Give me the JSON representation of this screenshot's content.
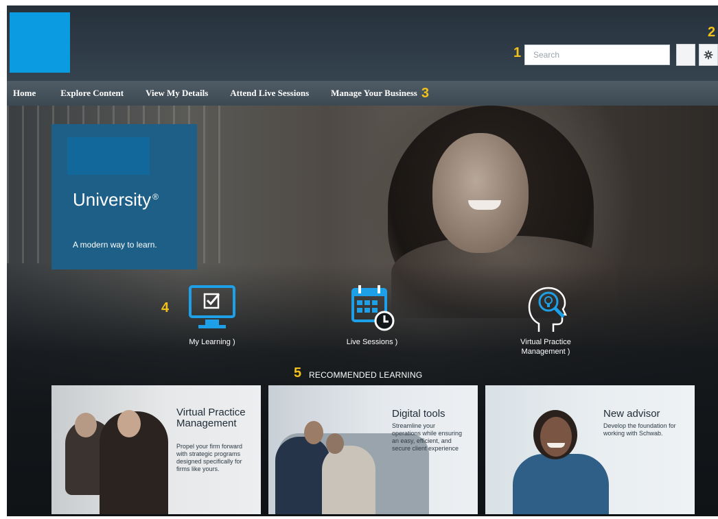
{
  "callouts": [
    "1",
    "2",
    "3",
    "4",
    "5"
  ],
  "header": {
    "search_placeholder": "Search"
  },
  "nav": {
    "items": [
      {
        "label": "Home"
      },
      {
        "label": "Explore Content"
      },
      {
        "label": "View My Details"
      },
      {
        "label": "Attend Live Sessions"
      },
      {
        "label": "Manage Your Business"
      }
    ]
  },
  "hero": {
    "brand_title": "University",
    "brand_mark": "®",
    "brand_tagline": "A modern way to learn."
  },
  "quick_links": [
    {
      "label": "My Learning )",
      "icon": "monitor-checkbox-icon"
    },
    {
      "label": "Live Sessions )",
      "icon": "calendar-clock-icon"
    },
    {
      "label": "Virtual Practice Management )",
      "icon": "head-lightbulb-icon"
    }
  ],
  "recommended": {
    "heading": "RECOMMENDED LEARNING",
    "cards": [
      {
        "title": "Virtual Practice Management",
        "description": "Propel your firm forward with strategic programs designed specifically for firms like yours."
      },
      {
        "title": "Digital tools",
        "description": "Streamline your operations while ensuring an easy, efficient, and secure client experience"
      },
      {
        "title": "New advisor",
        "description": "Develop the foundation for working with Schwab."
      }
    ]
  },
  "colors": {
    "logo_blue": "#0a9be0",
    "brand_panel": "#1d5f86",
    "icon_blue": "#1ea0e8",
    "callout_yellow": "#f2c21a"
  }
}
